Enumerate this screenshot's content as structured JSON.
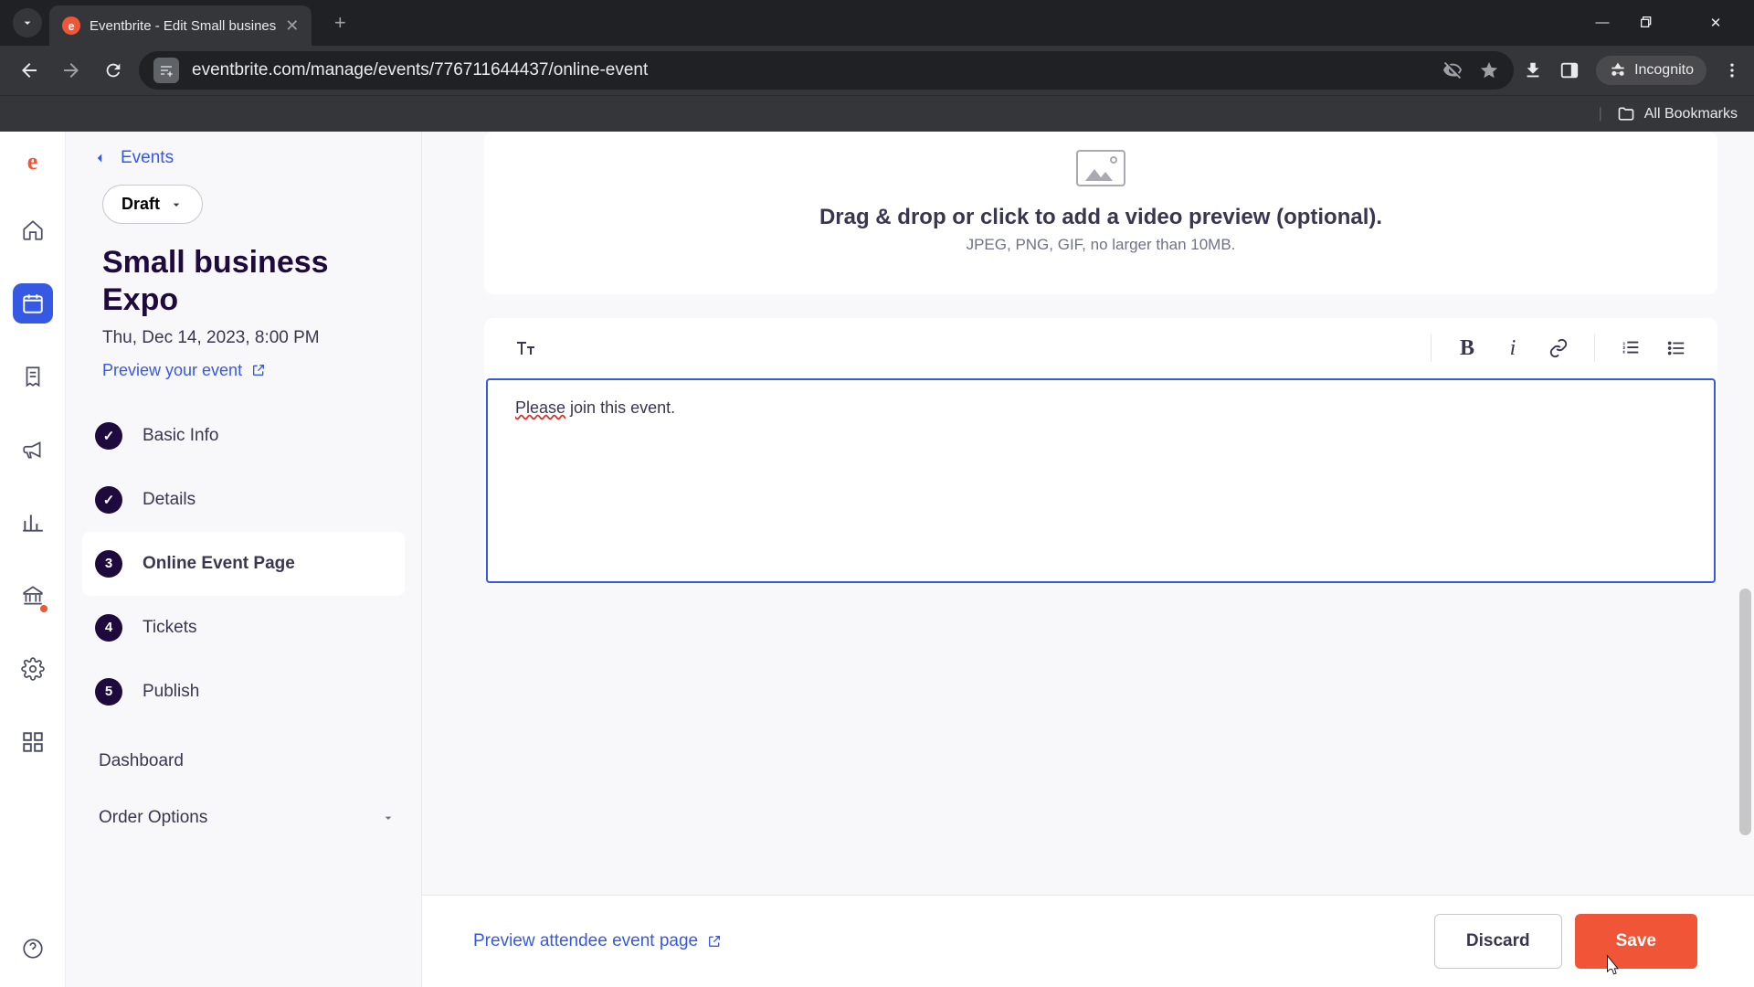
{
  "browser": {
    "tab_title": "Eventbrite - Edit Small busines",
    "url": "eventbrite.com/manage/events/776711644437/online-event",
    "incognito_label": "Incognito",
    "bookmarks_label": "All Bookmarks"
  },
  "sidebar": {
    "back_label": "Events",
    "status": "Draft",
    "event_title": "Small business Expo",
    "event_date": "Thu, Dec 14, 2023, 8:00 PM",
    "preview_label": "Preview your event",
    "steps": [
      {
        "label": "Basic Info",
        "badge": "check",
        "active": false
      },
      {
        "label": "Details",
        "badge": "check",
        "active": false
      },
      {
        "label": "Online Event Page",
        "badge": "3",
        "active": true
      },
      {
        "label": "Tickets",
        "badge": "4",
        "active": false
      },
      {
        "label": "Publish",
        "badge": "5",
        "active": false
      }
    ],
    "links": {
      "dashboard": "Dashboard",
      "order_options": "Order Options"
    }
  },
  "main": {
    "dropzone_title": "Drag & drop or click to add a video preview (optional).",
    "dropzone_sub": "JPEG, PNG, GIF, no larger than 10MB.",
    "editor_text_spellerr": "Please",
    "editor_text_rest": " join this event."
  },
  "footer": {
    "preview_label": "Preview attendee event page",
    "discard": "Discard",
    "save": "Save"
  }
}
